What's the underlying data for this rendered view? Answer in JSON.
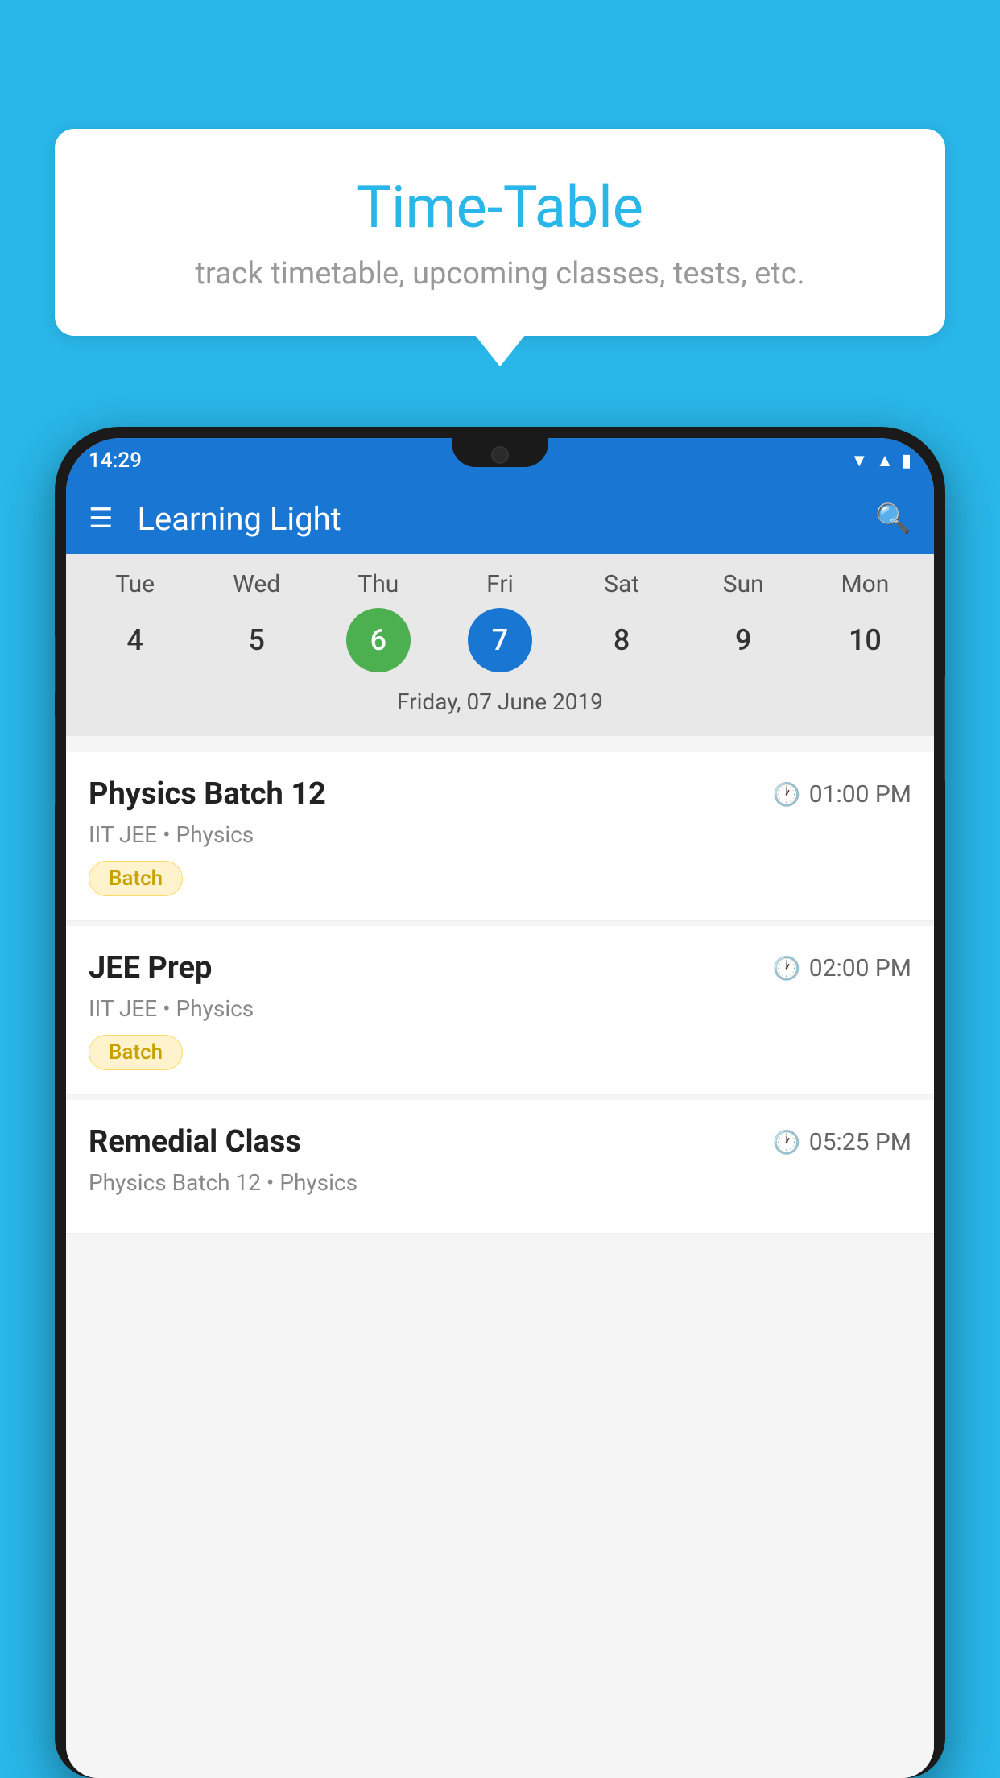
{
  "page": {
    "background_color": "#29b6e8"
  },
  "tooltip": {
    "title": "Time-Table",
    "subtitle": "track timetable, upcoming classes, tests, etc."
  },
  "phone": {
    "status_bar": {
      "time": "14:29"
    },
    "app_bar": {
      "title": "Learning Light"
    },
    "calendar": {
      "day_names": [
        "Tue",
        "Wed",
        "Thu",
        "Fri",
        "Sat",
        "Sun",
        "Mon"
      ],
      "day_numbers": [
        "4",
        "5",
        "6",
        "7",
        "8",
        "9",
        "10"
      ],
      "today_index": 2,
      "selected_index": 3,
      "selected_date": "Friday, 07 June 2019"
    },
    "schedule": [
      {
        "name": "Physics Batch 12",
        "time": "01:00 PM",
        "meta": "IIT JEE • Physics",
        "tag": "Batch"
      },
      {
        "name": "JEE Prep",
        "time": "02:00 PM",
        "meta": "IIT JEE • Physics",
        "tag": "Batch"
      },
      {
        "name": "Remedial Class",
        "time": "05:25 PM",
        "meta": "Physics Batch 12 • Physics",
        "tag": ""
      }
    ]
  }
}
